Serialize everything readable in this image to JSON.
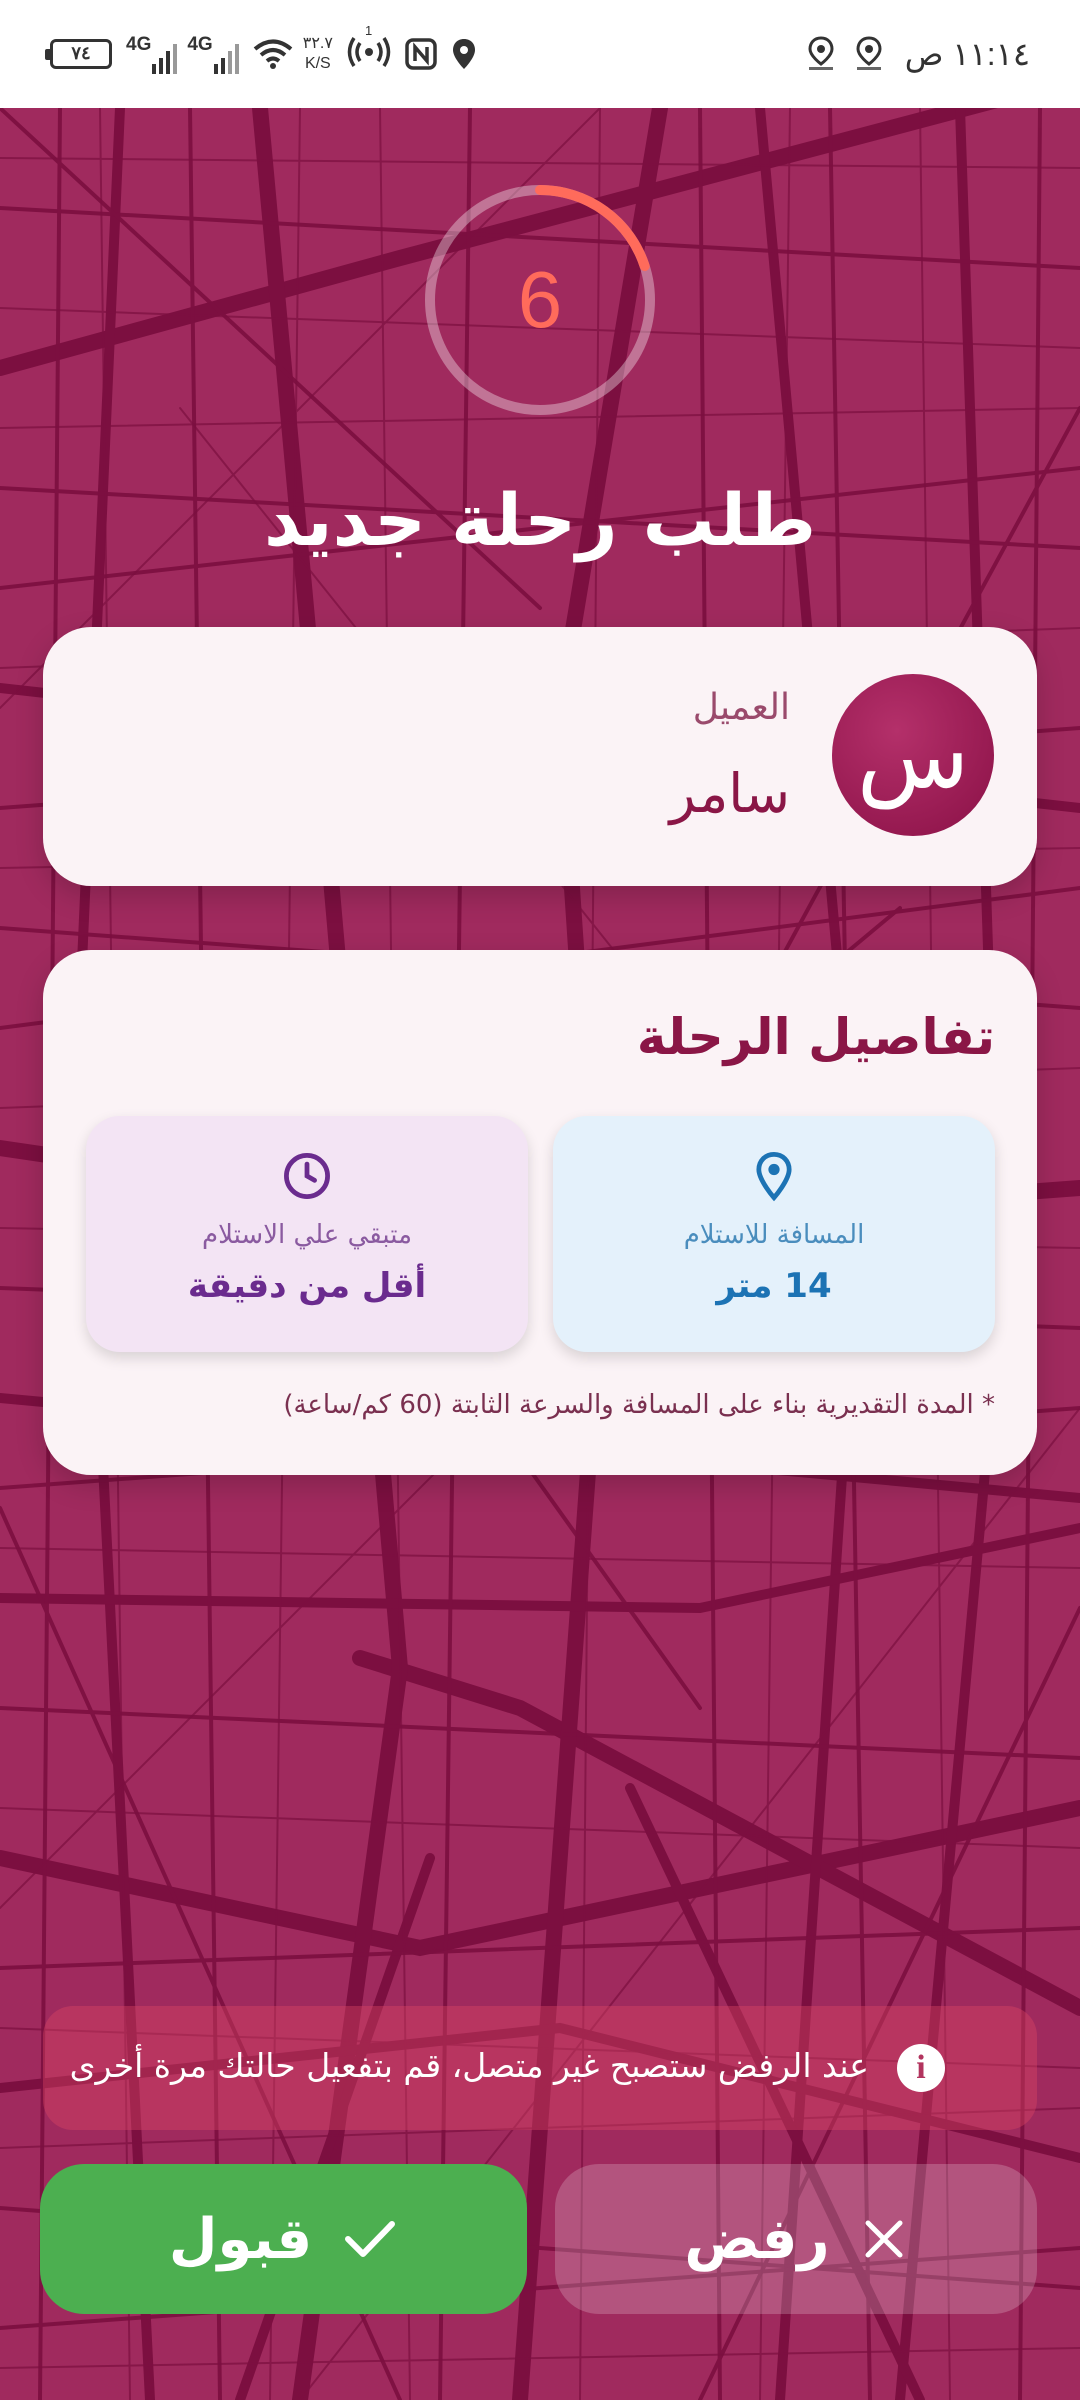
{
  "status_bar": {
    "time": "١١:١٤ ص",
    "battery": "٧٤",
    "network_1": "4G",
    "network_2": "4G",
    "speed_value": "٣٢.٧",
    "speed_unit": "K/S",
    "hotspot_badge": "1",
    "icons": [
      "battery-icon",
      "signal-icon",
      "wifi-icon",
      "hotspot-icon",
      "nfc-icon",
      "location-icon",
      "app-notification-icon"
    ]
  },
  "timer": {
    "value": "6",
    "progress_fraction": 0.2
  },
  "page_title": "طلب رحلة جديد",
  "customer": {
    "avatar_initial": "س",
    "label": "العميل",
    "name": "سامر"
  },
  "trip_details": {
    "title": "تفاصيل الرحلة",
    "distance": {
      "label": "المسافة للاستلام",
      "value": "14 متر",
      "icon": "location-pin-icon"
    },
    "time_left": {
      "label": "متبقي علي الاستلام",
      "value": "أقل من دقيقة",
      "icon": "clock-icon"
    },
    "note": "* المدة التقديرية بناء على المسافة والسرعة الثابتة (60 كم/ساعة)"
  },
  "warning": {
    "text": "عند الرفض ستصبح غير متصل، قم بتفعيل حالتك مرة أخرى",
    "icon": "info-icon"
  },
  "buttons": {
    "reject": "رفض",
    "accept": "قبول"
  },
  "colors": {
    "background": "#a02a5e",
    "accent": "#8a1646",
    "accept": "#4caf50",
    "timer": "#ff6b5b",
    "distance_bg": "#e4f1fb",
    "time_bg": "#f3e4f4"
  }
}
